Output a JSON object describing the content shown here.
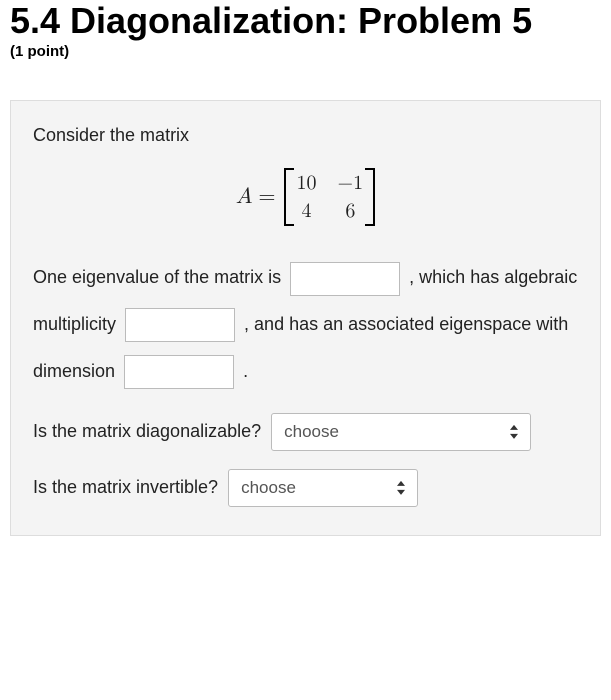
{
  "header": {
    "title": "5.4 Diagonalization: Problem 5",
    "points": "(1 point)"
  },
  "problem": {
    "prompt": "Consider the matrix",
    "matrix": {
      "lhs": "A",
      "equals": "=",
      "cells": [
        "10",
        "−1",
        "4",
        "6"
      ]
    },
    "text": {
      "t1": "One eigenvalue of the matrix is",
      "t2": ", which has",
      "t3": "algebraic multiplicity",
      "t4": ", and has an",
      "t5": "associated eigenspace with dimension",
      "t6": "."
    },
    "q1": {
      "label": "Is the matrix diagonalizable?",
      "placeholder": "choose"
    },
    "q2": {
      "label": "Is the matrix invertible?",
      "placeholder": "choose"
    }
  }
}
